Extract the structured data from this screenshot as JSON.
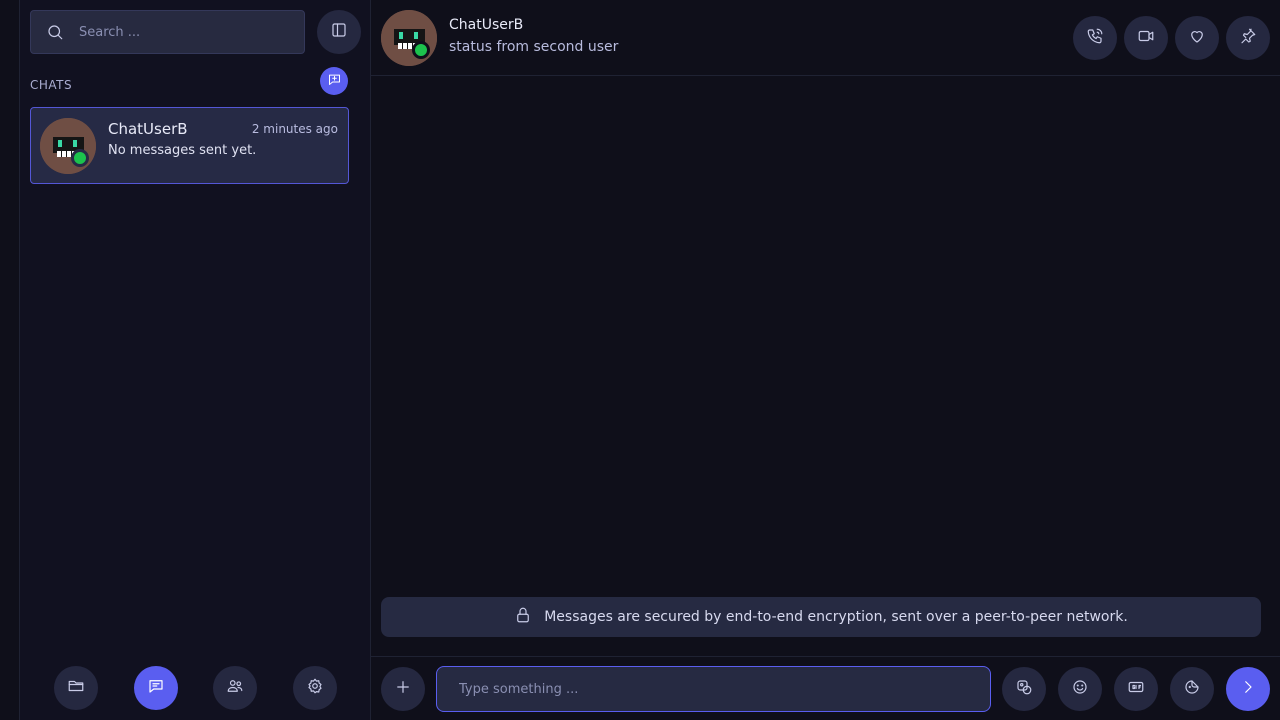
{
  "sidebar": {
    "search_placeholder": "Search ...",
    "chats_heading": "CHATS",
    "chat_list": [
      {
        "name": "ChatUserB",
        "time": "2 minutes ago",
        "preview": "No messages sent yet.",
        "status": "online"
      }
    ],
    "nav": [
      {
        "icon": "folder-icon",
        "active": false
      },
      {
        "icon": "chat-icon",
        "active": true
      },
      {
        "icon": "friends-icon",
        "active": false
      },
      {
        "icon": "settings-icon",
        "active": false
      }
    ]
  },
  "conversation": {
    "peer_name": "ChatUserB",
    "peer_status": "status from second user",
    "actions": [
      "phone-icon",
      "video-icon",
      "heart-icon",
      "pin-icon"
    ],
    "encryption_notice": "Messages are secured by end-to-end encryption, sent over a peer-to-peer network.",
    "composer": {
      "placeholder": "Type something ...",
      "value": "",
      "tools": [
        "image-icon",
        "emoji-icon",
        "gif-icon",
        "sticker-icon"
      ]
    }
  },
  "colors": {
    "accent": "#5a5ef0",
    "online": "#1cc24d",
    "background": "#0f0f1a",
    "panel": "#262a42"
  }
}
